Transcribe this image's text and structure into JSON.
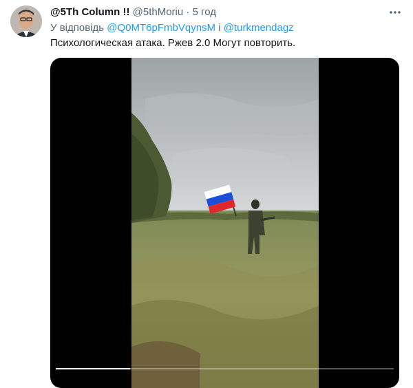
{
  "tweet": {
    "display_name": "@5Th Column !!",
    "handle": "@5thMoriu",
    "separator": "·",
    "time": "5 год",
    "reply_prefix": "У відповідь",
    "mention_1": "@Q0MT6pFmbVqynsM",
    "reply_joiner": "і",
    "mention_2": "@turkmendagz",
    "text": "Психологическая атака. Ржев 2.0 Могут повторить."
  },
  "icons": {
    "avatar": "avatar",
    "more": "more-icon"
  },
  "video": {
    "progress": 0.22
  },
  "colors": {
    "link": "#1d9bf0",
    "secondary_text": "#536471",
    "flag_white": "#ffffff",
    "flag_blue": "#1b4fd8",
    "flag_red": "#e0282a"
  }
}
